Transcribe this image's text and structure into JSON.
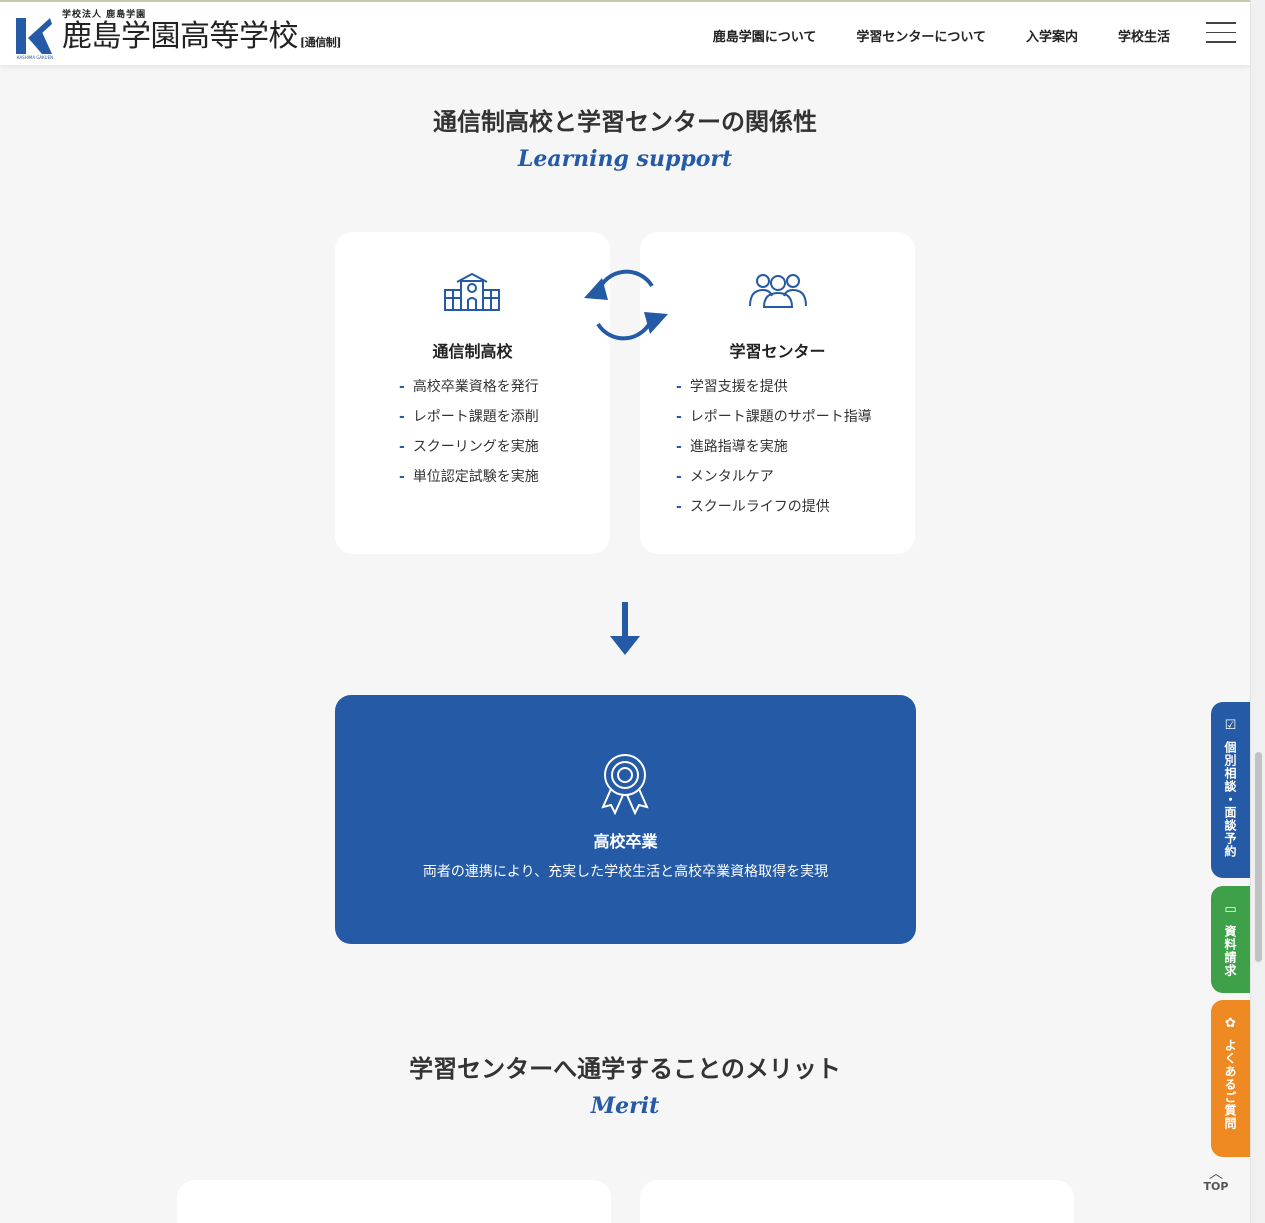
{
  "header": {
    "logo_sub": "学校法人 鹿島学園",
    "logo_main": "鹿島学園高等学校",
    "logo_tag": "[通信制]",
    "logo_en": "KASHIMA GAKUEN",
    "nav": [
      "鹿島学園について",
      "学習センターについて",
      "入学案内",
      "学校生活"
    ]
  },
  "section1": {
    "title": "通信制高校と学習センターの関係性",
    "subtitle": "Learning support"
  },
  "card_school": {
    "icon": "school-building-icon",
    "title": "通信制高校",
    "items": [
      "高校卒業資格を発行",
      "レポート課題を添削",
      "スクーリングを実施",
      "単位認定試験を実施"
    ]
  },
  "card_center": {
    "icon": "people-group-icon",
    "title": "学習センター",
    "items": [
      "学習支援を提供",
      "レポート課題のサポート指導",
      "進路指導を実施",
      "メンタルケア",
      "スクールライフの提供"
    ]
  },
  "result": {
    "icon": "award-ribbon-icon",
    "title": "高校卒業",
    "desc": "両者の連携により、充実した学校生活と高校卒業資格取得を実現"
  },
  "section2": {
    "title": "学習センターへ通学することのメリット",
    "subtitle": "Merit"
  },
  "side_tabs": [
    {
      "label": "個別相談・面談予約",
      "icon": "☑",
      "color": "#245aa6"
    },
    {
      "label": "資料請求",
      "icon": "▭",
      "color": "#3fa04a"
    },
    {
      "label": "よくあるご質問",
      "icon": "✿",
      "color": "#ef8a22"
    }
  ],
  "top_button": {
    "label": "TOP"
  },
  "colors": {
    "accent": "#245aa6",
    "background": "#f6f6f6"
  }
}
